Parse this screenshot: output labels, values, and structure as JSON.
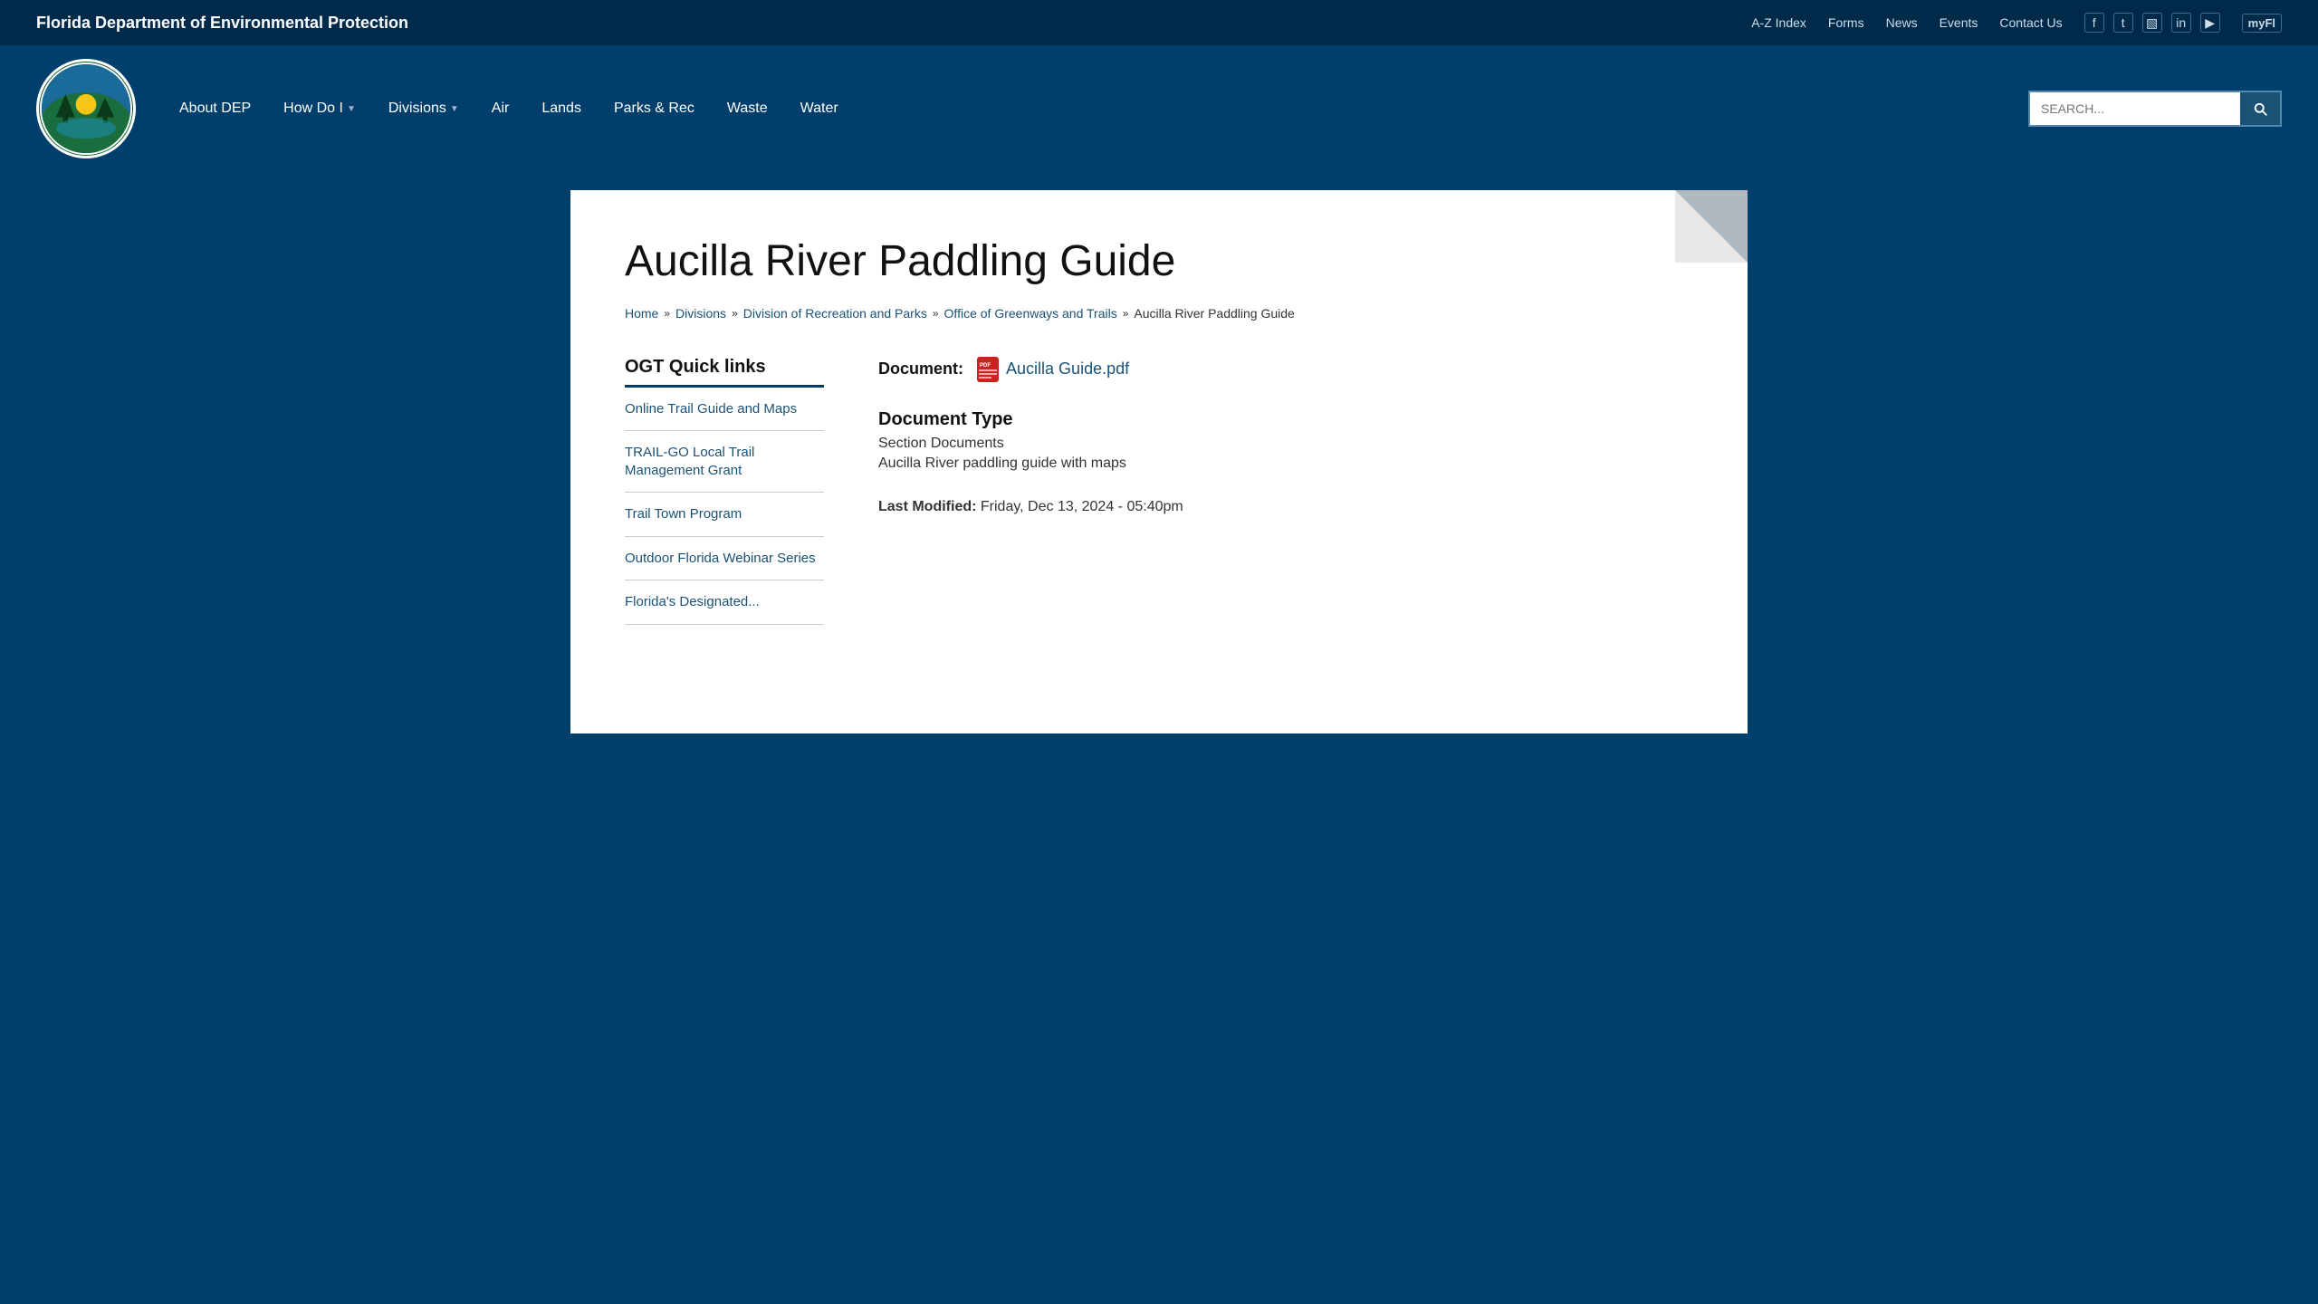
{
  "topbar": {
    "title": "Florida Department of Environmental Protection",
    "nav": [
      {
        "id": "az-index",
        "label": "A-Z Index"
      },
      {
        "id": "forms",
        "label": "Forms"
      },
      {
        "id": "news",
        "label": "News"
      },
      {
        "id": "events",
        "label": "Events"
      },
      {
        "id": "contact-us",
        "label": "Contact Us"
      }
    ],
    "social": [
      {
        "id": "facebook",
        "icon": "f"
      },
      {
        "id": "twitter",
        "icon": "t"
      },
      {
        "id": "instagram",
        "icon": "i"
      },
      {
        "id": "linkedin",
        "icon": "in"
      },
      {
        "id": "youtube",
        "icon": "▶"
      }
    ],
    "myflorida": "myFl"
  },
  "header": {
    "logo_alt": "Florida Department of Environmental Protection Logo",
    "nav": [
      {
        "id": "about-dep",
        "label": "About DEP",
        "has_dropdown": false
      },
      {
        "id": "how-do-i",
        "label": "How Do I",
        "has_dropdown": true
      },
      {
        "id": "divisions",
        "label": "Divisions",
        "has_dropdown": true
      },
      {
        "id": "air",
        "label": "Air",
        "has_dropdown": false
      },
      {
        "id": "lands",
        "label": "Lands",
        "has_dropdown": false
      },
      {
        "id": "parks-rec",
        "label": "Parks & Rec",
        "has_dropdown": false
      },
      {
        "id": "waste",
        "label": "Waste",
        "has_dropdown": false
      },
      {
        "id": "water",
        "label": "Water",
        "has_dropdown": false
      }
    ],
    "search_placeholder": "SEARCH..."
  },
  "breadcrumb": [
    {
      "id": "home",
      "label": "Home",
      "href": "#"
    },
    {
      "id": "divisions",
      "label": "Divisions",
      "href": "#"
    },
    {
      "id": "division-of-recreation-and-parks",
      "label": "Division of Recreation and Parks",
      "href": "#"
    },
    {
      "id": "office-of-greenways-and-trails",
      "label": "Office of Greenways and Trails",
      "href": "#"
    },
    {
      "id": "current",
      "label": "Aucilla River Paddling Guide"
    }
  ],
  "page": {
    "title": "Aucilla River Paddling Guide"
  },
  "sidebar": {
    "title": "OGT Quick links",
    "items": [
      {
        "id": "online-trail-guide",
        "label": "Online Trail Guide and Maps"
      },
      {
        "id": "trail-go",
        "label": "TRAIL-GO Local Trail Management Grant"
      },
      {
        "id": "trail-town",
        "label": "Trail Town Program"
      },
      {
        "id": "outdoor-webinar",
        "label": "Outdoor Florida Webinar Series"
      },
      {
        "id": "floridas-designated",
        "label": "Florida's Designated..."
      }
    ]
  },
  "document": {
    "label": "Document:",
    "filename": "Aucilla Guide.pdf",
    "type_label": "Document Type",
    "type_value": "Section Documents",
    "description": "Aucilla River paddling guide with maps",
    "last_modified_label": "Last Modified:",
    "last_modified_value": "Friday, Dec 13, 2024 - 05:40pm"
  }
}
